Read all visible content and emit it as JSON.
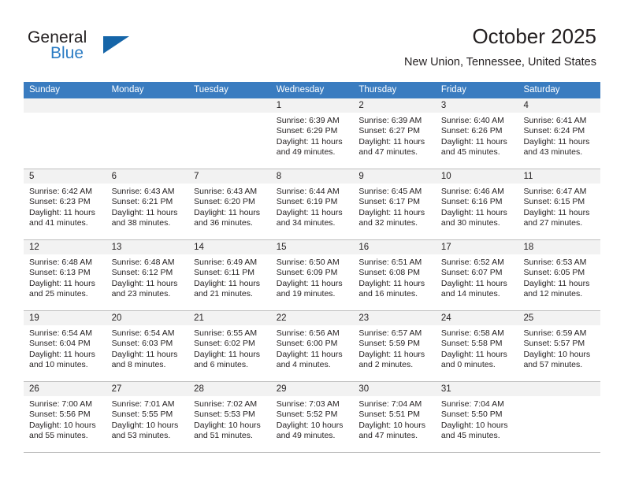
{
  "brand": {
    "word_general": "General",
    "word_blue": "Blue",
    "triangle_color": "#1565a8"
  },
  "header": {
    "title": "October 2025",
    "subtitle": "New Union, Tennessee, United States"
  },
  "theme": {
    "header_row_bg": "#3a7cc0",
    "day_band_bg": "#f2f2f2",
    "grid_line": "#bfbfbf",
    "text": "#231f20"
  },
  "weekdays": [
    "Sunday",
    "Monday",
    "Tuesday",
    "Wednesday",
    "Thursday",
    "Friday",
    "Saturday"
  ],
  "labels": {
    "sunrise_prefix": "Sunrise:",
    "sunset_prefix": "Sunset:",
    "daylight_prefix": "Daylight:"
  },
  "weeks": [
    [
      {
        "day": "",
        "sunrise": "",
        "sunset": "",
        "daylight": "",
        "empty": true
      },
      {
        "day": "",
        "sunrise": "",
        "sunset": "",
        "daylight": "",
        "empty": true
      },
      {
        "day": "",
        "sunrise": "",
        "sunset": "",
        "daylight": "",
        "empty": true
      },
      {
        "day": "1",
        "sunrise": "Sunrise: 6:39 AM",
        "sunset": "Sunset: 6:29 PM",
        "daylight": "Daylight: 11 hours and 49 minutes.",
        "empty": false
      },
      {
        "day": "2",
        "sunrise": "Sunrise: 6:39 AM",
        "sunset": "Sunset: 6:27 PM",
        "daylight": "Daylight: 11 hours and 47 minutes.",
        "empty": false
      },
      {
        "day": "3",
        "sunrise": "Sunrise: 6:40 AM",
        "sunset": "Sunset: 6:26 PM",
        "daylight": "Daylight: 11 hours and 45 minutes.",
        "empty": false
      },
      {
        "day": "4",
        "sunrise": "Sunrise: 6:41 AM",
        "sunset": "Sunset: 6:24 PM",
        "daylight": "Daylight: 11 hours and 43 minutes.",
        "empty": false
      }
    ],
    [
      {
        "day": "5",
        "sunrise": "Sunrise: 6:42 AM",
        "sunset": "Sunset: 6:23 PM",
        "daylight": "Daylight: 11 hours and 41 minutes.",
        "empty": false
      },
      {
        "day": "6",
        "sunrise": "Sunrise: 6:43 AM",
        "sunset": "Sunset: 6:21 PM",
        "daylight": "Daylight: 11 hours and 38 minutes.",
        "empty": false
      },
      {
        "day": "7",
        "sunrise": "Sunrise: 6:43 AM",
        "sunset": "Sunset: 6:20 PM",
        "daylight": "Daylight: 11 hours and 36 minutes.",
        "empty": false
      },
      {
        "day": "8",
        "sunrise": "Sunrise: 6:44 AM",
        "sunset": "Sunset: 6:19 PM",
        "daylight": "Daylight: 11 hours and 34 minutes.",
        "empty": false
      },
      {
        "day": "9",
        "sunrise": "Sunrise: 6:45 AM",
        "sunset": "Sunset: 6:17 PM",
        "daylight": "Daylight: 11 hours and 32 minutes.",
        "empty": false
      },
      {
        "day": "10",
        "sunrise": "Sunrise: 6:46 AM",
        "sunset": "Sunset: 6:16 PM",
        "daylight": "Daylight: 11 hours and 30 minutes.",
        "empty": false
      },
      {
        "day": "11",
        "sunrise": "Sunrise: 6:47 AM",
        "sunset": "Sunset: 6:15 PM",
        "daylight": "Daylight: 11 hours and 27 minutes.",
        "empty": false
      }
    ],
    [
      {
        "day": "12",
        "sunrise": "Sunrise: 6:48 AM",
        "sunset": "Sunset: 6:13 PM",
        "daylight": "Daylight: 11 hours and 25 minutes.",
        "empty": false
      },
      {
        "day": "13",
        "sunrise": "Sunrise: 6:48 AM",
        "sunset": "Sunset: 6:12 PM",
        "daylight": "Daylight: 11 hours and 23 minutes.",
        "empty": false
      },
      {
        "day": "14",
        "sunrise": "Sunrise: 6:49 AM",
        "sunset": "Sunset: 6:11 PM",
        "daylight": "Daylight: 11 hours and 21 minutes.",
        "empty": false
      },
      {
        "day": "15",
        "sunrise": "Sunrise: 6:50 AM",
        "sunset": "Sunset: 6:09 PM",
        "daylight": "Daylight: 11 hours and 19 minutes.",
        "empty": false
      },
      {
        "day": "16",
        "sunrise": "Sunrise: 6:51 AM",
        "sunset": "Sunset: 6:08 PM",
        "daylight": "Daylight: 11 hours and 16 minutes.",
        "empty": false
      },
      {
        "day": "17",
        "sunrise": "Sunrise: 6:52 AM",
        "sunset": "Sunset: 6:07 PM",
        "daylight": "Daylight: 11 hours and 14 minutes.",
        "empty": false
      },
      {
        "day": "18",
        "sunrise": "Sunrise: 6:53 AM",
        "sunset": "Sunset: 6:05 PM",
        "daylight": "Daylight: 11 hours and 12 minutes.",
        "empty": false
      }
    ],
    [
      {
        "day": "19",
        "sunrise": "Sunrise: 6:54 AM",
        "sunset": "Sunset: 6:04 PM",
        "daylight": "Daylight: 11 hours and 10 minutes.",
        "empty": false
      },
      {
        "day": "20",
        "sunrise": "Sunrise: 6:54 AM",
        "sunset": "Sunset: 6:03 PM",
        "daylight": "Daylight: 11 hours and 8 minutes.",
        "empty": false
      },
      {
        "day": "21",
        "sunrise": "Sunrise: 6:55 AM",
        "sunset": "Sunset: 6:02 PM",
        "daylight": "Daylight: 11 hours and 6 minutes.",
        "empty": false
      },
      {
        "day": "22",
        "sunrise": "Sunrise: 6:56 AM",
        "sunset": "Sunset: 6:00 PM",
        "daylight": "Daylight: 11 hours and 4 minutes.",
        "empty": false
      },
      {
        "day": "23",
        "sunrise": "Sunrise: 6:57 AM",
        "sunset": "Sunset: 5:59 PM",
        "daylight": "Daylight: 11 hours and 2 minutes.",
        "empty": false
      },
      {
        "day": "24",
        "sunrise": "Sunrise: 6:58 AM",
        "sunset": "Sunset: 5:58 PM",
        "daylight": "Daylight: 11 hours and 0 minutes.",
        "empty": false
      },
      {
        "day": "25",
        "sunrise": "Sunrise: 6:59 AM",
        "sunset": "Sunset: 5:57 PM",
        "daylight": "Daylight: 10 hours and 57 minutes.",
        "empty": false
      }
    ],
    [
      {
        "day": "26",
        "sunrise": "Sunrise: 7:00 AM",
        "sunset": "Sunset: 5:56 PM",
        "daylight": "Daylight: 10 hours and 55 minutes.",
        "empty": false
      },
      {
        "day": "27",
        "sunrise": "Sunrise: 7:01 AM",
        "sunset": "Sunset: 5:55 PM",
        "daylight": "Daylight: 10 hours and 53 minutes.",
        "empty": false
      },
      {
        "day": "28",
        "sunrise": "Sunrise: 7:02 AM",
        "sunset": "Sunset: 5:53 PM",
        "daylight": "Daylight: 10 hours and 51 minutes.",
        "empty": false
      },
      {
        "day": "29",
        "sunrise": "Sunrise: 7:03 AM",
        "sunset": "Sunset: 5:52 PM",
        "daylight": "Daylight: 10 hours and 49 minutes.",
        "empty": false
      },
      {
        "day": "30",
        "sunrise": "Sunrise: 7:04 AM",
        "sunset": "Sunset: 5:51 PM",
        "daylight": "Daylight: 10 hours and 47 minutes.",
        "empty": false
      },
      {
        "day": "31",
        "sunrise": "Sunrise: 7:04 AM",
        "sunset": "Sunset: 5:50 PM",
        "daylight": "Daylight: 10 hours and 45 minutes.",
        "empty": false
      },
      {
        "day": "",
        "sunrise": "",
        "sunset": "",
        "daylight": "",
        "empty": true
      }
    ]
  ]
}
